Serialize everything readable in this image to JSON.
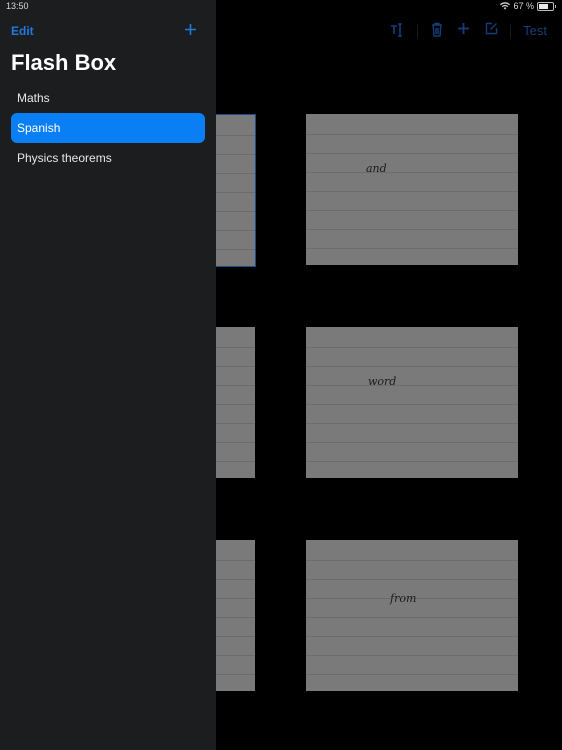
{
  "status_bar": {
    "time": "13:50",
    "battery_percent": "67 %",
    "battery_level": 0.67
  },
  "sidebar": {
    "edit_label": "Edit",
    "add_icon": "plus-icon",
    "title": "Flash Box",
    "decks": [
      {
        "label": "Maths",
        "selected": false
      },
      {
        "label": "Spanish",
        "selected": true
      },
      {
        "label": "Physics theorems",
        "selected": false
      }
    ]
  },
  "toolbar": {
    "text_icon": "text-cursor-icon",
    "trash_icon": "trash-icon",
    "add_icon": "plus-icon",
    "edit_icon": "compose-icon",
    "test_label": "Test"
  },
  "cards": [
    {
      "row": 1,
      "left_text": "",
      "right_text": "and",
      "left_selected": true
    },
    {
      "row": 2,
      "left_text": "",
      "right_text": "word",
      "left_selected": false
    },
    {
      "row": 3,
      "left_text": "",
      "right_text": "from",
      "left_selected": false
    }
  ],
  "colors": {
    "accent": "#0a7ff5",
    "sidebar_bg": "#1b1d1f",
    "card": "#7a7a7a"
  }
}
